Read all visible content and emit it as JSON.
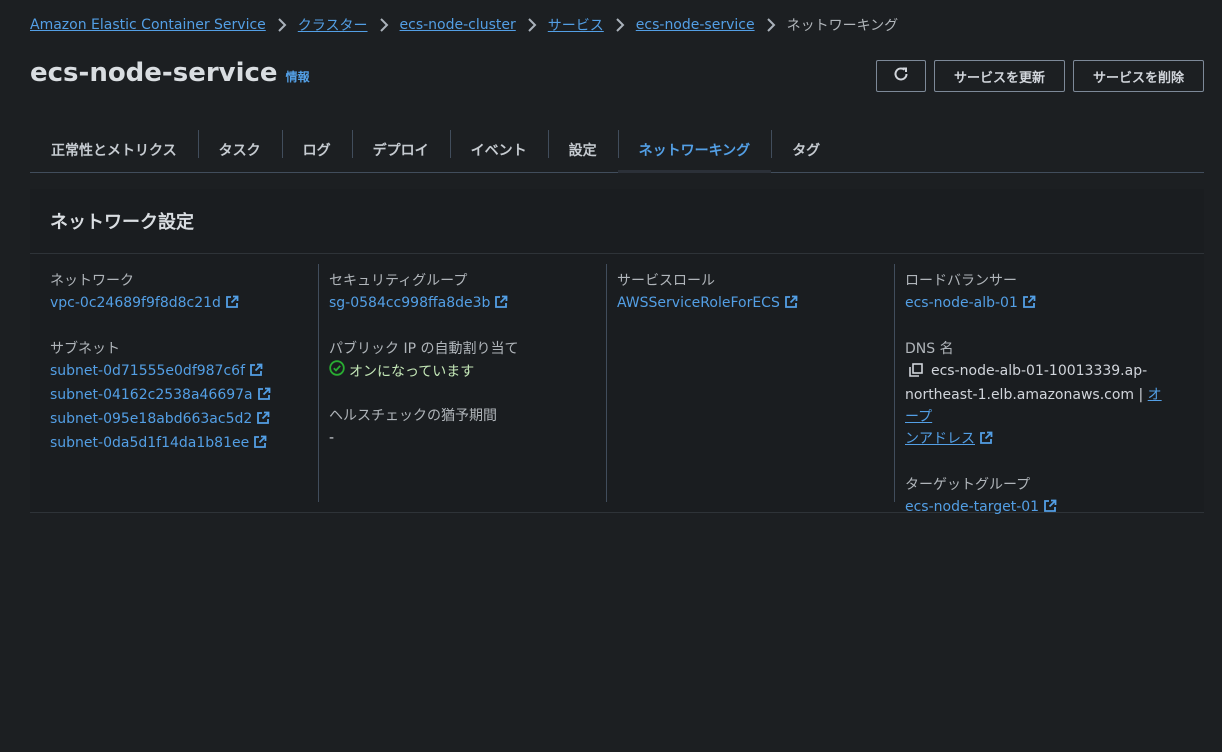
{
  "breadcrumb": {
    "items": [
      "Amazon Elastic Container Service",
      "クラスター",
      "ecs-node-cluster",
      "サービス",
      "ecs-node-service"
    ],
    "current": "ネットワーキング"
  },
  "header": {
    "title": "ecs-node-service",
    "info": "情報",
    "refresh_icon": "refresh-icon",
    "update_button": "サービスを更新",
    "delete_button": "サービスを削除"
  },
  "tabs": [
    {
      "label": "正常性とメトリクス"
    },
    {
      "label": "タスク"
    },
    {
      "label": "ログ"
    },
    {
      "label": "デプロイ"
    },
    {
      "label": "イベント"
    },
    {
      "label": "設定"
    },
    {
      "label": "ネットワーキング",
      "active": true
    },
    {
      "label": "タグ"
    }
  ],
  "panel": {
    "title": "ネットワーク設定",
    "network": {
      "label": "ネットワーク",
      "value": "vpc-0c24689f9f8d8c21d"
    },
    "subnet": {
      "label": "サブネット",
      "values": [
        "subnet-0d71555e0df987c6f",
        "subnet-04162c2538a46697a",
        "subnet-095e18abd663ac5d2",
        "subnet-0da5d1f14da1b81ee"
      ]
    },
    "security_group": {
      "label": "セキュリティグループ",
      "value": "sg-0584cc998ffa8de3b"
    },
    "public_ip": {
      "label": "パブリック IP の自動割り当て",
      "value": "オンになっています"
    },
    "health_grace": {
      "label": "ヘルスチェックの猶予期間",
      "value": "-"
    },
    "service_role": {
      "label": "サービスロール",
      "value": "AWSServiceRoleForECS"
    },
    "load_balancer": {
      "label": "ロードバランサー",
      "value": "ecs-node-alb-01"
    },
    "dns": {
      "label": "DNS 名",
      "value_line1": "ecs-node-alb-01-10013339.ap-",
      "value_line2": "northeast-1.elb.amazonaws.com",
      "separator": "|",
      "open_line1": "オープ",
      "open_line2": "ンアドレス"
    },
    "target_group": {
      "label": "ターゲットグループ",
      "value": "ecs-node-target-01"
    }
  },
  "colors": {
    "link": "#539fe5",
    "background": "#1c1f22",
    "success": "#29ad32"
  }
}
